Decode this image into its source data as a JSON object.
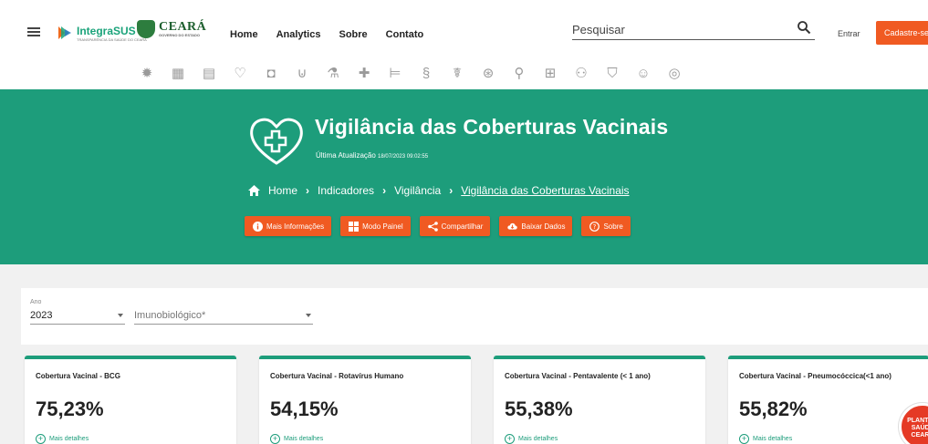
{
  "header": {
    "brand_integra": "IntegraSUS",
    "brand_integra_tagline": "TRANSPARÊNCIA DA SAÚDE DO CEARÁ",
    "brand_ceara": "CEARÁ",
    "brand_ceara_tagline": "GOVERNO DO ESTADO",
    "nav": [
      "Home",
      "Analytics",
      "Sobre",
      "Contato"
    ],
    "search_placeholder": "Pesquisar",
    "login_label": "Entrar",
    "signup_label": "Cadastre-se"
  },
  "icon_bar": {
    "icons": [
      "virus-icon",
      "hospital-icon",
      "document-search-icon",
      "heart-hands-icon",
      "camera-medical-icon",
      "tooth-icon",
      "microscope-icon",
      "medical-cross-icon",
      "hospital-bed-icon",
      "pregnancy-icon",
      "brain-head-icon",
      "accessibility-icon",
      "ribbon-icon",
      "money-icon",
      "family-icon",
      "badge-icon",
      "head-profile-icon",
      "search-person-icon"
    ]
  },
  "hero": {
    "title": "Vigilância das Coberturas Vacinais",
    "updated_label": "Última Atualização",
    "updated_value": "18/07/2023 09:02:55",
    "breadcrumb": [
      "Home",
      "Indicadores",
      "Vigilância",
      "Vigilância das Coberturas Vacinais"
    ],
    "buttons": [
      "Mais Informações",
      "Modo Painel",
      "Compartilhar",
      "Baixar Dados",
      "Sobre"
    ]
  },
  "filters": {
    "ano_label": "Ano",
    "ano_value": "2023",
    "imuno_placeholder": "Imunobiológico*"
  },
  "cards": [
    {
      "title": "Cobertura Vacinal - BCG",
      "value": "75,23%",
      "more": "Mais detalhes"
    },
    {
      "title": "Cobertura Vacinal - Rotavírus Humano",
      "value": "54,15%",
      "more": "Mais detalhes"
    },
    {
      "title": "Cobertura Vacinal - Pentavalente (< 1 ano)",
      "value": "55,38%",
      "more": "Mais detalhes"
    },
    {
      "title": "Cobertura Vacinal - Pneumocóccica(<1 ano)",
      "value": "55,82%",
      "more": "Mais detalhes"
    }
  ],
  "floating_badge": "PLANTÃO SAÚDE CEARÁ",
  "colors": {
    "primary_green": "#1d9d7b",
    "accent_orange": "#f05a22"
  }
}
